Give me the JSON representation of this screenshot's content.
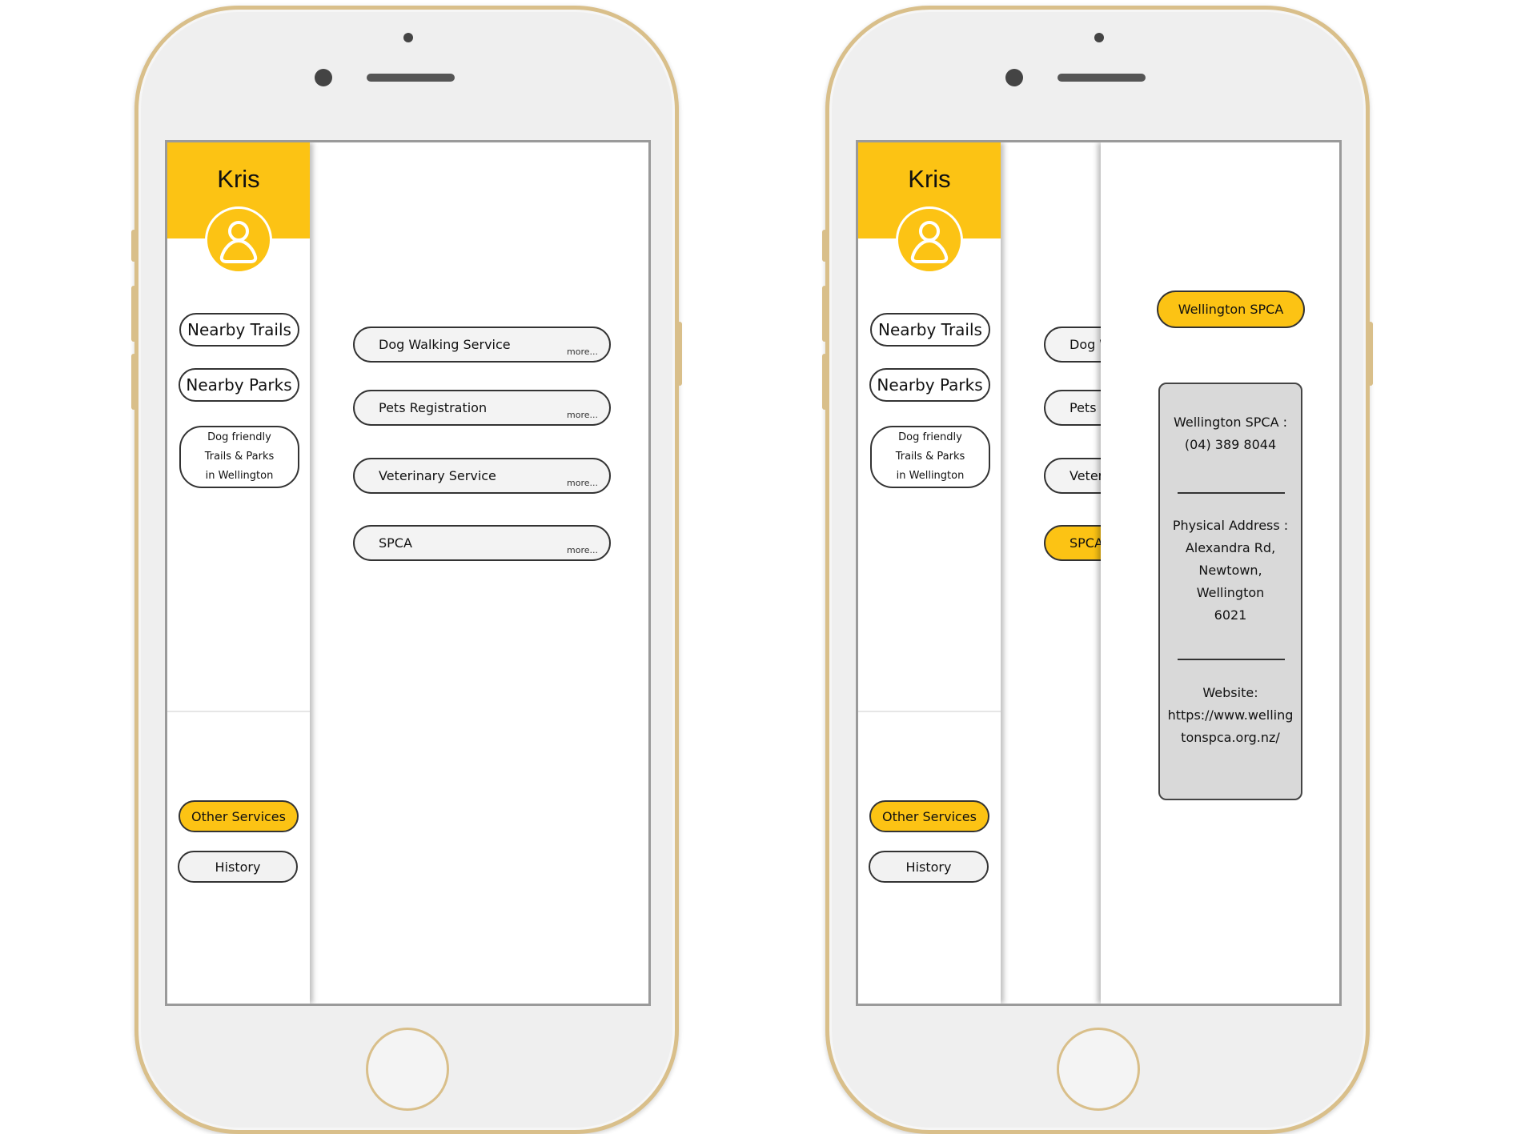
{
  "user": {
    "name": "Kris"
  },
  "menu": {
    "nearby_trails": "Nearby Trails",
    "nearby_parks": "Nearby Parks",
    "dog_friendly": "Dog friendly\nTrails & Parks\nin Wellington",
    "other_services": "Other Services",
    "history": "History"
  },
  "services": [
    {
      "label": "Dog Walking Service",
      "more": "more..."
    },
    {
      "label": "Pets Registration",
      "more": "more..."
    },
    {
      "label": "Veterinary Service",
      "more": "more..."
    },
    {
      "label": "SPCA",
      "more": "more..."
    }
  ],
  "services_clipped": [
    "Dog W",
    "Pets R",
    "Veter",
    "SPCA"
  ],
  "spca_detail": {
    "title": "Wellington SPCA",
    "phone_label": "Wellington SPCA :",
    "phone": "(04) 389 8044",
    "address_label": "Physical Address :",
    "address_line1": "Alexandra Rd,",
    "address_line2": "Newtown,",
    "address_line3": "Wellington",
    "address_line4": "6021",
    "website_label": "Website:",
    "website_line1": "https://www.welling",
    "website_line2": "tonspca.org.nz/"
  },
  "colors": {
    "accent": "#fcc314",
    "frame": "#d9bf8a",
    "card": "#d9d9d9"
  }
}
